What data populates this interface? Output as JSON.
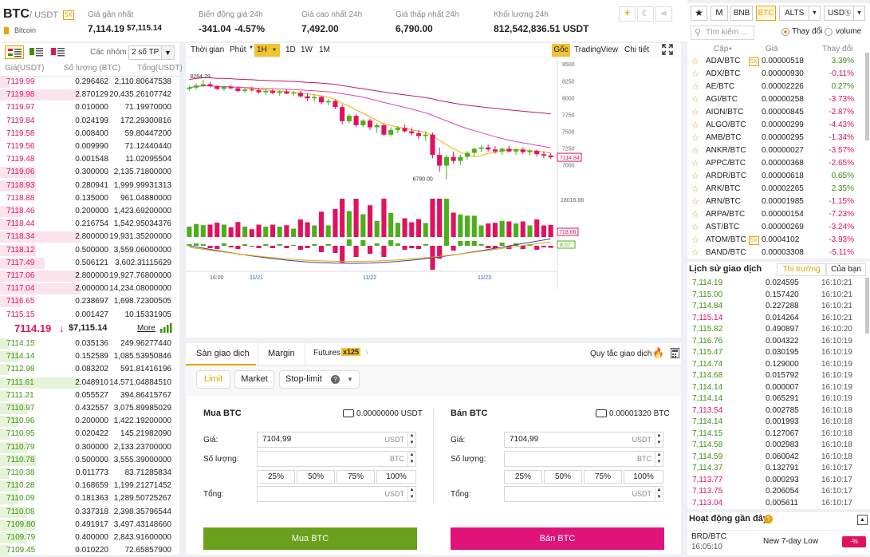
{
  "header": {
    "symbol": "BTC",
    "quote": "/ USDT",
    "leverage": "5X",
    "name": "Bitcoin",
    "last_label": "Giá gần nhất",
    "last_price": "7,114.19",
    "last_usd": "$7,115.14",
    "change_label": "Biến động giá 24h",
    "change": "-341.04",
    "change_pct": "-4.57%",
    "high_label": "Giá cao nhất 24h",
    "high": "7,492.00",
    "low_label": "Giá thấp nhất 24h",
    "low": "6,790.00",
    "vol_label": "Khối lượng 24h",
    "vol": "812,542,836.51 USDT",
    "icons": [
      "sun-icon",
      "moon-icon",
      "share-icon"
    ]
  },
  "orderbook": {
    "group_label": "Các nhóm",
    "group_value": "2 số TP",
    "cols": [
      "Giá(USDT)",
      "Số lượng (BTC)",
      "Tổng(USDT)"
    ],
    "asks": [
      [
        "7119.99",
        "0.296462",
        "2,110.80647538"
      ],
      [
        "7119.98",
        "2.870129",
        "20,435.26107742"
      ],
      [
        "7119.97",
        "0.010000",
        "71.19970000"
      ],
      [
        "7119.84",
        "0.024199",
        "172.29300816"
      ],
      [
        "7119.58",
        "0.008400",
        "59.80447200"
      ],
      [
        "7119.56",
        "0.009990",
        "71.12440440"
      ],
      [
        "7119.48",
        "0.001548",
        "11.02095504"
      ],
      [
        "7119.06",
        "0.300000",
        "2,135.71800000"
      ],
      [
        "7118.93",
        "0.280941",
        "1,999.99931313"
      ],
      [
        "7118.88",
        "0.135000",
        "961.04880000"
      ],
      [
        "7118.46",
        "0.200000",
        "1,423.69200000"
      ],
      [
        "7118.44",
        "0.216754",
        "1,542.95034376"
      ],
      [
        "7118.34",
        "2.800000",
        "19,931.35200000"
      ],
      [
        "7118.12",
        "0.500000",
        "3,559.06000000"
      ],
      [
        "7117.49",
        "0.506121",
        "3,602.31115629"
      ],
      [
        "7117.06",
        "2.800000",
        "19,927.76800000"
      ],
      [
        "7117.04",
        "2.000000",
        "14,234.08000000"
      ],
      [
        "7116.65",
        "0.238697",
        "1,698.72300505"
      ],
      [
        "7115.15",
        "0.001427",
        "10.15331905"
      ]
    ],
    "ask_depth": [
      0.05,
      0.45,
      0,
      0,
      0,
      0,
      0,
      0.2,
      0.2,
      0,
      0.12,
      0.1,
      0.45,
      0.2,
      0.25,
      0.45,
      0.45,
      0.12,
      0
    ],
    "mid_price": "7114.19",
    "mid_arrow": "↓",
    "mid_usd": "$7,115.14",
    "more": "More",
    "bids": [
      [
        "7114.15",
        "0.035136",
        "249.96277440"
      ],
      [
        "7114.14",
        "0.152589",
        "1,085.53950846"
      ],
      [
        "7112.98",
        "0.083202",
        "591.81416196"
      ],
      [
        "7111.61",
        "2.048910",
        "14,571.04884510"
      ],
      [
        "7111.21",
        "0.055527",
        "394.86415767"
      ],
      [
        "7110.97",
        "0.432557",
        "3,075.89985029"
      ],
      [
        "7110.96",
        "0.200000",
        "1,422.19200000"
      ],
      [
        "7110.95",
        "0.020422",
        "145.21982090"
      ],
      [
        "7110.79",
        "0.300000",
        "2,133.23700000"
      ],
      [
        "7110.78",
        "0.500000",
        "3,555.39000000"
      ],
      [
        "7110.38",
        "0.011773",
        "83.71285834"
      ],
      [
        "7110.28",
        "0.168659",
        "1,199.21271452"
      ],
      [
        "7110.09",
        "0.181363",
        "1,289.50725267"
      ],
      [
        "7110.08",
        "0.337318",
        "2,398.35796544"
      ],
      [
        "7109.80",
        "0.491917",
        "3,497.43148660"
      ],
      [
        "7109.79",
        "0.400000",
        "2,843.91600000"
      ],
      [
        "7109.45",
        "0.010220",
        "72.65857900"
      ]
    ],
    "bid_depth": [
      0.05,
      0.1,
      0.05,
      0.45,
      0.05,
      0.15,
      0.1,
      0.05,
      0.15,
      0.2,
      0.05,
      0.1,
      0.1,
      0.15,
      0.2,
      0.15,
      0.05
    ]
  },
  "chart_toolbar": {
    "time": "Thời gian",
    "unit": "Phút",
    "active": "1H",
    "intervals": [
      "1D",
      "1W",
      "1M"
    ],
    "views": [
      "Gốc",
      "TradingView",
      "Chi tiết"
    ]
  },
  "chart_data": {
    "type": "candlestick",
    "x_ticks": [
      "16:00",
      "11/21",
      "11/22",
      "11/23"
    ],
    "y_ticks": [
      8500,
      8250,
      8000,
      7750,
      7500,
      7250,
      7000
    ],
    "ylim": [
      6700,
      8550
    ],
    "price_tag": "7114.84",
    "high_marker": "8264.29",
    "low_marker": "6790.00",
    "vol_ticks": [
      "18016.88"
    ],
    "vol_tag": "718.66",
    "macd_tag": "8.07",
    "candles": [
      [
        8130,
        8180,
        8100,
        8150
      ],
      [
        8150,
        8210,
        8120,
        8180
      ],
      [
        8180,
        8264,
        8160,
        8200
      ],
      [
        8200,
        8230,
        8150,
        8170
      ],
      [
        8170,
        8190,
        8110,
        8130
      ],
      [
        8130,
        8180,
        8100,
        8160
      ],
      [
        8160,
        8190,
        8120,
        8140
      ],
      [
        8140,
        8170,
        8080,
        8100
      ],
      [
        8100,
        8150,
        8070,
        8120
      ],
      [
        8120,
        8160,
        8090,
        8110
      ],
      [
        8110,
        8140,
        8060,
        8080
      ],
      [
        8080,
        8120,
        8040,
        8100
      ],
      [
        8100,
        8130,
        8050,
        8070
      ],
      [
        8070,
        8110,
        8030,
        8090
      ],
      [
        8090,
        8120,
        8050,
        8060
      ],
      [
        8060,
        8100,
        8020,
        8070
      ],
      [
        8070,
        8100,
        8000,
        8020
      ],
      [
        8020,
        8070,
        7950,
        7990
      ],
      [
        7990,
        8040,
        7940,
        8010
      ],
      [
        8010,
        8030,
        7900,
        7930
      ],
      [
        7930,
        7980,
        7880,
        7950
      ],
      [
        7950,
        7970,
        7830,
        7860
      ],
      [
        7860,
        7900,
        7600,
        7650
      ],
      [
        7650,
        7760,
        7620,
        7730
      ],
      [
        7730,
        7760,
        7560,
        7590
      ],
      [
        7590,
        7680,
        7560,
        7660
      ],
      [
        7660,
        7690,
        7520,
        7560
      ],
      [
        7560,
        7620,
        7480,
        7590
      ],
      [
        7590,
        7620,
        7430,
        7450
      ],
      [
        7450,
        7560,
        7420,
        7520
      ],
      [
        7520,
        7580,
        7470,
        7550
      ],
      [
        7550,
        7600,
        7480,
        7500
      ],
      [
        7500,
        7560,
        7440,
        7470
      ],
      [
        7470,
        7520,
        7380,
        7430
      ],
      [
        7430,
        7500,
        7360,
        7450
      ],
      [
        7450,
        7480,
        7100,
        7150
      ],
      [
        7150,
        7260,
        6900,
        6990
      ],
      [
        6990,
        7150,
        6790,
        7120
      ],
      [
        7120,
        7200,
        7020,
        7060
      ],
      [
        7060,
        7150,
        7000,
        7120
      ],
      [
        7120,
        7210,
        7080,
        7180
      ],
      [
        7180,
        7260,
        7130,
        7240
      ],
      [
        7240,
        7290,
        7190,
        7260
      ],
      [
        7260,
        7300,
        7200,
        7230
      ],
      [
        7230,
        7280,
        7170,
        7200
      ],
      [
        7200,
        7260,
        7150,
        7240
      ],
      [
        7240,
        7280,
        7180,
        7200
      ],
      [
        7200,
        7250,
        7150,
        7230
      ],
      [
        7230,
        7260,
        7160,
        7190
      ],
      [
        7190,
        7240,
        7140,
        7210
      ],
      [
        7210,
        7230,
        7130,
        7160
      ],
      [
        7160,
        7200,
        7100,
        7140
      ],
      [
        7140,
        7180,
        7090,
        7114
      ]
    ]
  },
  "trade": {
    "tabs": [
      "Sàn giao dịch",
      "Margin",
      "Futures"
    ],
    "futures_badge": "x125",
    "rules": "Quy tắc giao dịch",
    "order_types": [
      "Limit",
      "Market",
      "Stop-limit"
    ],
    "buy": {
      "title": "Mua BTC",
      "balance": "0.00000000 USDT",
      "price_label": "Giá:",
      "price": "7104,99",
      "price_unit": "USDT",
      "qty_label": "Số lượng:",
      "qty_unit": "BTC",
      "total_label": "Tổng:",
      "total_unit": "USDT",
      "button": "Mua BTC"
    },
    "sell": {
      "title": "Bán BTC",
      "balance": "0.00001320 BTC",
      "price_label": "Giá:",
      "price": "7104,99",
      "price_unit": "USDT",
      "qty_label": "Số lượng:",
      "qty_unit": "BTC",
      "total_label": "Tổng:",
      "total_unit": "USDT",
      "button": "Bán BTC"
    },
    "pcts": [
      "25%",
      "50%",
      "75%",
      "100%"
    ]
  },
  "market": {
    "tabs": [
      "M",
      "BNB",
      "BTC",
      "ALTS",
      "USD"
    ],
    "active": "BTC",
    "search_placeholder": "Tìm kiếm ...",
    "radio_change": "Thay đổi",
    "radio_volume": "volume",
    "cols": [
      "Cặp",
      "Giá",
      "Thay đổi"
    ],
    "pairs": [
      [
        "ADA/BTC",
        "5X",
        "0.00000518",
        "3.39%",
        "up"
      ],
      [
        "ADX/BTC",
        "",
        "0.00000930",
        "-0.11%",
        "down"
      ],
      [
        "AE/BTC",
        "",
        "0.00002226",
        "0.27%",
        "up"
      ],
      [
        "AGI/BTC",
        "",
        "0.00000258",
        "-3.73%",
        "down"
      ],
      [
        "AION/BTC",
        "",
        "0.00000845",
        "-2.87%",
        "down"
      ],
      [
        "ALGO/BTC",
        "",
        "0.00000299",
        "-4.43%",
        "down"
      ],
      [
        "AMB/BTC",
        "",
        "0.00000295",
        "-1.34%",
        "down"
      ],
      [
        "ANKR/BTC",
        "",
        "0.00000027",
        "-3.57%",
        "down"
      ],
      [
        "APPC/BTC",
        "",
        "0.00000368",
        "-2.65%",
        "down"
      ],
      [
        "ARDR/BTC",
        "",
        "0.00000618",
        "0.65%",
        "up"
      ],
      [
        "ARK/BTC",
        "",
        "0.00002265",
        "2.35%",
        "up"
      ],
      [
        "ARN/BTC",
        "",
        "0.00001985",
        "-1.15%",
        "down"
      ],
      [
        "ARPA/BTC",
        "",
        "0.00000154",
        "-7.23%",
        "down"
      ],
      [
        "AST/BTC",
        "",
        "0.00000269",
        "-3.24%",
        "down"
      ],
      [
        "ATOM/BTC",
        "5X",
        "0.0004102",
        "-3.93%",
        "down"
      ],
      [
        "BAND/BTC",
        "",
        "0.00003308",
        "-5.11%",
        "down"
      ]
    ]
  },
  "history": {
    "title": "Lịch sử giao dịch",
    "tabs": [
      "Thị trường",
      "Của bạn"
    ],
    "rows": [
      [
        "7,114.19",
        "0.024595",
        "16:10:21",
        "up"
      ],
      [
        "7,115.00",
        "0.157420",
        "16:10:21",
        "up"
      ],
      [
        "7,114.84",
        "0.227288",
        "16:10:21",
        "up"
      ],
      [
        "7,115.14",
        "0.014264",
        "16:10:21",
        "down"
      ],
      [
        "7,115.82",
        "0.490897",
        "16:10:20",
        "up"
      ],
      [
        "7,116.76",
        "0.004322",
        "16:10:19",
        "up"
      ],
      [
        "7,115.47",
        "0.030195",
        "16:10:19",
        "up"
      ],
      [
        "7,114.74",
        "0.129000",
        "16:10:19",
        "up"
      ],
      [
        "7,114.68",
        "0.015792",
        "16:10:19",
        "up"
      ],
      [
        "7,114.14",
        "0.000007",
        "16:10:19",
        "up"
      ],
      [
        "7,114.14",
        "0.065291",
        "16:10:19",
        "up"
      ],
      [
        "7,113.54",
        "0.002785",
        "16:10:18",
        "down"
      ],
      [
        "7,114.14",
        "0.001993",
        "16:10:18",
        "up"
      ],
      [
        "7,114.15",
        "0.127067",
        "16:10:18",
        "up"
      ],
      [
        "7,114.58",
        "0.002983",
        "16:10:18",
        "up"
      ],
      [
        "7,114.59",
        "0.060042",
        "16:10:18",
        "up"
      ],
      [
        "7,114.37",
        "0.132791",
        "16:10:17",
        "up"
      ],
      [
        "7,113.77",
        "0.000293",
        "16:10:17",
        "down"
      ],
      [
        "7,113.75",
        "0.206054",
        "16:10:17",
        "down"
      ],
      [
        "7,113.04",
        "0.005611",
        "16:10:17",
        "down"
      ]
    ]
  },
  "activity": {
    "title": "Hoạt động gần đây",
    "pair": "BRD/BTC",
    "time": "16:05:10",
    "event": "New 7-day Low",
    "badge": "-%"
  }
}
